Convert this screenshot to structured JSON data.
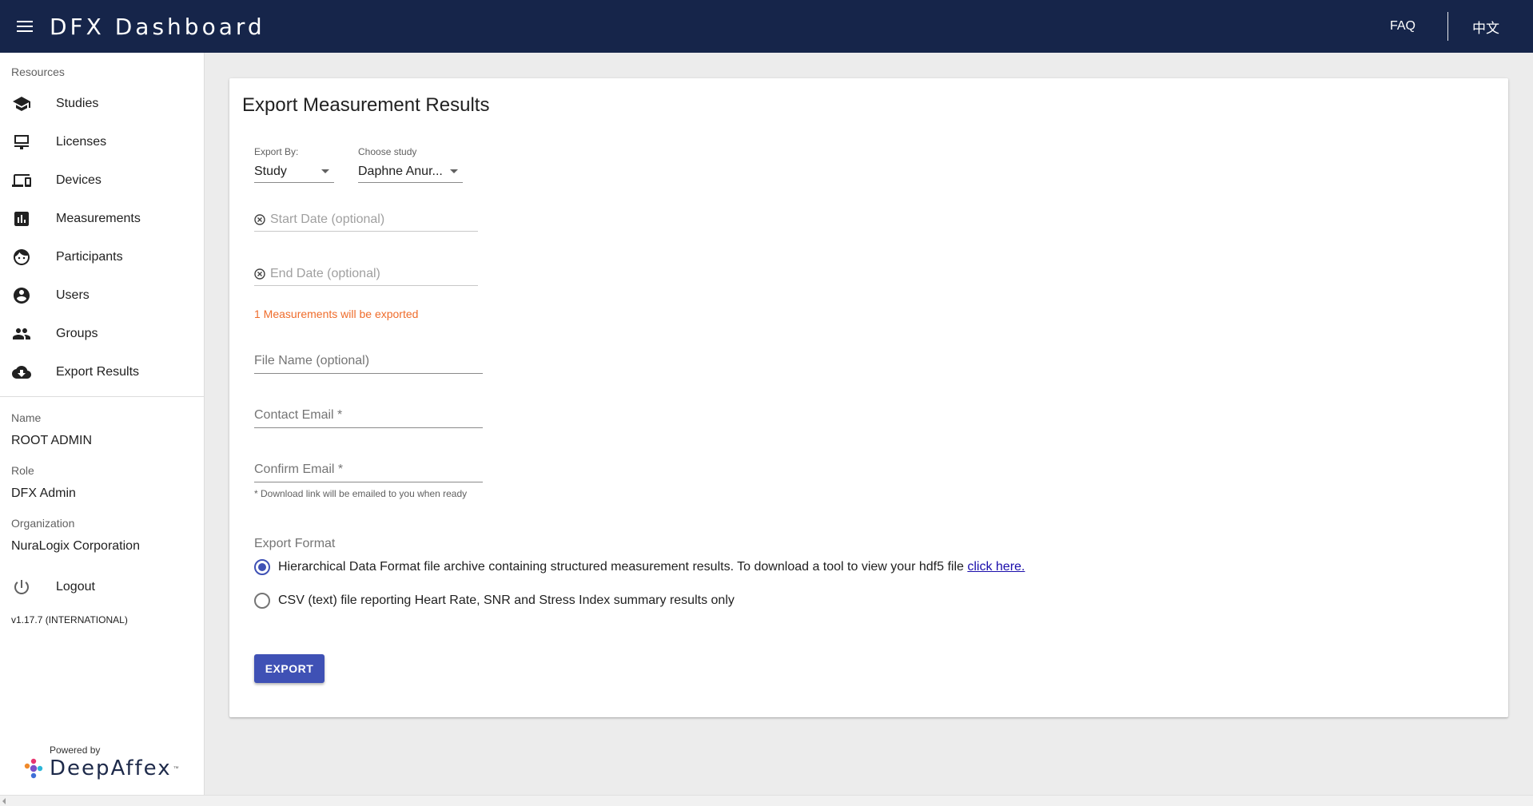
{
  "header": {
    "title": "DFX Dashboard",
    "faq": "FAQ",
    "language": "中文",
    "bg_color": "#16254a"
  },
  "sidebar": {
    "resources_label": "Resources",
    "items": [
      {
        "label": "Studies",
        "icon": "school-icon"
      },
      {
        "label": "Licenses",
        "icon": "license-icon"
      },
      {
        "label": "Devices",
        "icon": "devices-icon"
      },
      {
        "label": "Measurements",
        "icon": "bar-chart-icon"
      },
      {
        "label": "Participants",
        "icon": "face-icon"
      },
      {
        "label": "Users",
        "icon": "account-circle-icon"
      },
      {
        "label": "Groups",
        "icon": "people-icon"
      },
      {
        "label": "Export Results",
        "icon": "cloud-download-icon"
      }
    ],
    "name_label": "Name",
    "name_value": "ROOT ADMIN",
    "role_label": "Role",
    "role_value": "DFX Admin",
    "org_label": "Organization",
    "org_value": "NuraLogix Corporation",
    "logout": "Logout",
    "version": "v1.17.7 (INTERNATIONAL)",
    "powered_by": "Powered by",
    "brand": "DeepAffex",
    "brand_tm": "™"
  },
  "main": {
    "title": "Export Measurement Results",
    "export_by_label": "Export By:",
    "export_by_value": "Study",
    "choose_study_label": "Choose study",
    "choose_study_value": "Daphne Anur...",
    "start_date_placeholder": "Start Date (optional)",
    "end_date_placeholder": "End Date (optional)",
    "count_note": "1 Measurements will be exported",
    "file_name_placeholder": "File Name (optional)",
    "contact_email_placeholder": "Contact Email *",
    "confirm_email_placeholder": "Confirm Email *",
    "email_helper": "* Download link will be emailed to you when ready",
    "format_label": "Export Format",
    "format_options": [
      {
        "text": "Hierarchical Data Format file archive containing structured measurement results. To download a tool to view your hdf5 file ",
        "link": "click here.",
        "selected": true
      },
      {
        "text": "CSV (text) file reporting Heart Rate, SNR and Stress Index summary results only",
        "selected": false
      }
    ],
    "export_button": "EXPORT",
    "accent_color": "#3f51b5",
    "note_color": "#ef6c2b"
  }
}
